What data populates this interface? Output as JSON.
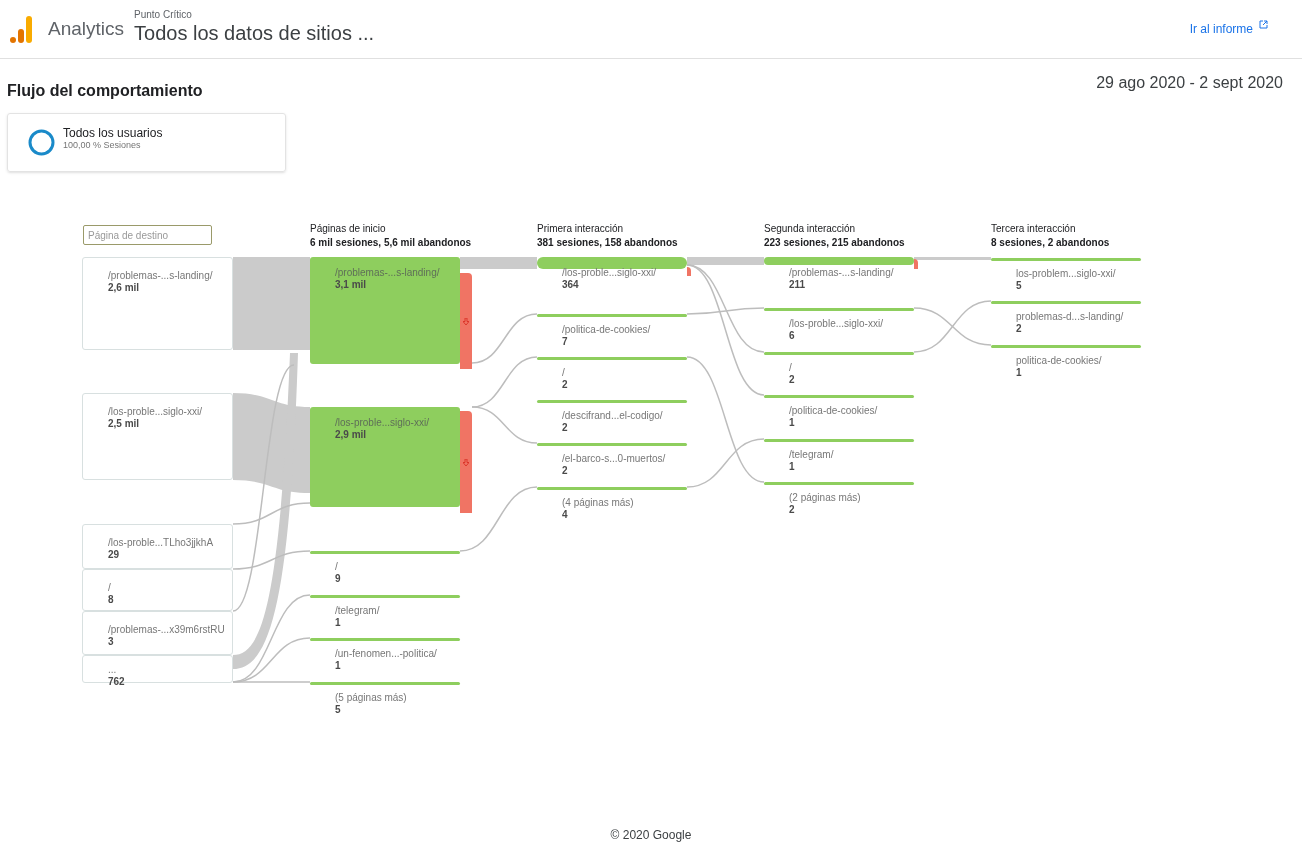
{
  "header": {
    "product": "Analytics",
    "account": "Punto Crítico",
    "property": "Todos los datos de sitios ...",
    "report_link": "Ir al informe"
  },
  "page": {
    "title": "Flujo del comportamiento",
    "date_range": "29 ago 2020 - 2 sept 2020"
  },
  "segment": {
    "name": "Todos los usuarios",
    "share": "100,00 % Sesiones"
  },
  "dimension_field": {
    "placeholder": "Página de destino"
  },
  "landing_pages": [
    {
      "label": "/problemas-...s-landing/",
      "value": "2,6 mil"
    },
    {
      "label": "/los-proble...siglo-xxi/",
      "value": "2,5 mil"
    },
    {
      "label": "/los-proble...TLho3jjkhA",
      "value": "29"
    },
    {
      "label": "/",
      "value": "8"
    },
    {
      "label": "/problemas-...x39m6rstRU",
      "value": "3"
    },
    {
      "label": "...",
      "value": "762"
    }
  ],
  "columns": [
    {
      "title": "Páginas de inicio",
      "summary": "6 mil sesiones, 5,6 mil abandonos",
      "nodes": [
        {
          "kind": "block",
          "label": "/problemas-...s-landing/",
          "value": "3,1 mil",
          "dropoff": true
        },
        {
          "kind": "block",
          "label": "/los-proble...siglo-xxi/",
          "value": "2,9 mil",
          "dropoff": true
        },
        {
          "kind": "bar",
          "label": "/",
          "value": "9",
          "dropoff": false
        },
        {
          "kind": "bar",
          "label": "/telegram/",
          "value": "1",
          "dropoff": false
        },
        {
          "kind": "bar",
          "label": "/un-fenomen...-politica/",
          "value": "1",
          "dropoff": false
        },
        {
          "kind": "bar",
          "label": "(5 páginas más)",
          "value": "5",
          "dropoff": false
        }
      ]
    },
    {
      "title": "Primera interacción",
      "summary": "381 sesiones, 158 abandonos",
      "nodes": [
        {
          "kind": "bar",
          "label": "/los-proble...siglo-xxi/",
          "value": "364",
          "dropoff": true
        },
        {
          "kind": "bar",
          "label": "/politica-de-cookies/",
          "value": "7",
          "dropoff": false
        },
        {
          "kind": "bar",
          "label": "/",
          "value": "2",
          "dropoff": false
        },
        {
          "kind": "bar",
          "label": "/descifrand...el-codigo/",
          "value": "2",
          "dropoff": false
        },
        {
          "kind": "bar",
          "label": "/el-barco-s...0-muertos/",
          "value": "2",
          "dropoff": false
        },
        {
          "kind": "bar",
          "label": "(4 páginas más)",
          "value": "4",
          "dropoff": false
        }
      ]
    },
    {
      "title": "Segunda interacción",
      "summary": "223 sesiones, 215 abandonos",
      "nodes": [
        {
          "kind": "bar",
          "label": "/problemas-...s-landing/",
          "value": "211",
          "dropoff": true
        },
        {
          "kind": "bar",
          "label": "/los-proble...siglo-xxi/",
          "value": "6",
          "dropoff": false
        },
        {
          "kind": "bar",
          "label": "/",
          "value": "2",
          "dropoff": false
        },
        {
          "kind": "bar",
          "label": "/politica-de-cookies/",
          "value": "1",
          "dropoff": false
        },
        {
          "kind": "bar",
          "label": "/telegram/",
          "value": "1",
          "dropoff": false
        },
        {
          "kind": "bar",
          "label": "(2 páginas más)",
          "value": "2",
          "dropoff": false
        }
      ]
    },
    {
      "title": "Tercera interacción",
      "summary": "8 sesiones, 2 abandonos",
      "nodes": [
        {
          "kind": "bar",
          "label": "los-problem...siglo-xxi/",
          "value": "5",
          "dropoff": false
        },
        {
          "kind": "bar",
          "label": "problemas-d...s-landing/",
          "value": "2",
          "dropoff": false
        },
        {
          "kind": "bar",
          "label": "politica-de-cookies/",
          "value": "1",
          "dropoff": false
        }
      ]
    }
  ],
  "footer": "© 2020 Google"
}
